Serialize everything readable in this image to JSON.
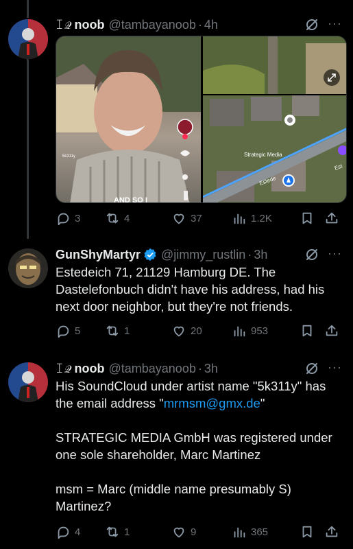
{
  "tweets": [
    {
      "name": "noob",
      "name_glyph": "ꀤ𝒬",
      "handle": "@tambayanoob",
      "time": "4h",
      "media": {
        "left_caption_top": "5k311y",
        "left_caption_bottom": "AND SO I",
        "map_label_1": "Strategic Media",
        "map_label_2": "Estede",
        "map_label_3": "Est",
        "map_label_4": "edeich"
      },
      "stats": {
        "replies": "3",
        "reposts": "4",
        "likes": "37",
        "views": "1.2K"
      }
    },
    {
      "name": "GunShyMartyr",
      "handle": "@jimmy_rustlin",
      "time": "3h",
      "text": "Estedeich 71, 21129 Hamburg DE. The Dastelefonbuch didn't have his address, had his next door neighbor, but they're not friends.",
      "stats": {
        "replies": "5",
        "reposts": "1",
        "likes": "20",
        "views": "953"
      }
    },
    {
      "name": "noob",
      "name_glyph": "ꀤ𝒬",
      "handle": "@tambayanoob",
      "time": "3h",
      "text_p1_a": "His SoundCloud under artist name \"5k311y\" has the email address \"",
      "text_p1_link": "mrmsm@gmx.de",
      "text_p1_b": "\"",
      "text_p2": "STRATEGIC MEDIA GmbH was registered under one sole shareholder, Marc Martinez",
      "text_p3": "msm = Marc (middle name presumably S) Martinez?",
      "stats": {
        "replies": "4",
        "reposts": "1",
        "likes": "9",
        "views": "365"
      }
    }
  ],
  "separator": "·",
  "more_glyph": "···",
  "colors": {
    "background": "#000000",
    "text": "#e7e9ea",
    "muted": "#71767b",
    "link": "#1d9bf0",
    "verified": "#1d9bf0"
  }
}
